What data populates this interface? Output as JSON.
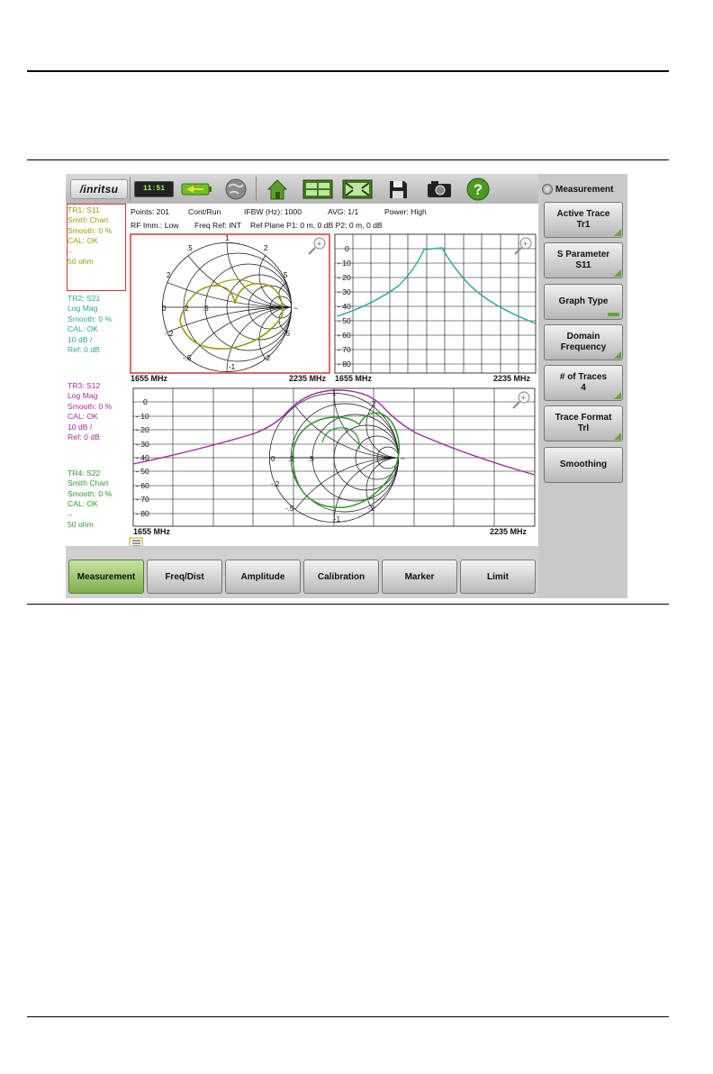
{
  "toolbar": {
    "logo": "/inritsu",
    "clock": "11:51"
  },
  "status": {
    "points": "Points: 201",
    "mode": "Cont/Run",
    "ifbw": "IFBW (Hz): 1000",
    "avg": "AVG: 1/1",
    "power": "Power: High",
    "rf_imm": "RF Imm.: Low",
    "freq_ref": "Freq Ref: INT",
    "ref_plane": "Ref Plane P1: 0 m, 0 dB P2: 0 m, 0 dB"
  },
  "traces": [
    {
      "lines": [
        "TR1: S11",
        "Smith Chart",
        "Smooth: 0 %",
        "CAL: OK",
        "--",
        "50 ohm"
      ],
      "color": "#9a9a10"
    },
    {
      "lines": [
        "TR2: S21",
        "Log Mag",
        "Smooth: 0 %",
        "CAL: OK",
        "10 dB /",
        "Ref: 0 dB"
      ],
      "color": "#2aa89a"
    },
    {
      "lines": [
        "TR3: S12",
        "Log Mag",
        "Smooth: 0 %",
        "CAL: OK",
        "10 dB /",
        "Ref: 0 dB"
      ],
      "color": "#a32aa8"
    },
    {
      "lines": [
        "TR4: S22",
        "Smith Chart",
        "Smooth: 0 %",
        "CAL: OK",
        "--",
        "50 ohm"
      ],
      "color": "#2a9a2a"
    }
  ],
  "plots": {
    "tr1_start": "1655 MHz",
    "tr1_stop": "2235 MHz",
    "tr2_start": "1655 MHz",
    "tr2_stop": "2235 MHz",
    "tr34_start": "1655 MHz",
    "tr34_stop": "2235 MHz",
    "db_ticks": [
      "0",
      "- 10",
      "- 20",
      "- 30",
      "- 40",
      "- 50",
      "- 60",
      "- 70",
      "- 80"
    ],
    "smith_labels": [
      "1",
      ".5",
      "2",
      ".2",
      "5",
      "0",
      ".2",
      ".5",
      "1",
      "2",
      "5",
      "~",
      "-.2",
      "-5",
      "-.5",
      "-2",
      "-1"
    ]
  },
  "right_panel": {
    "header": "Measurement",
    "buttons": [
      {
        "line1": "Active Trace",
        "line2": "Tr1"
      },
      {
        "line1": "S Parameter",
        "line2": "S11"
      },
      {
        "line1": "Graph Type",
        "line2": ""
      },
      {
        "line1": "Domain",
        "line2": "Frequency"
      },
      {
        "line1": "# of Traces",
        "line2": "4"
      },
      {
        "line1": "Trace Format",
        "line2": "Trl"
      },
      {
        "line1": "Smoothing",
        "line2": ""
      }
    ]
  },
  "bottom_menu": [
    "Measurement",
    "Freq/Dist",
    "Amplitude",
    "Calibration",
    "Marker",
    "Limit"
  ],
  "colors": {
    "tr1": "#9a9a10",
    "tr2": "#2aa89a",
    "tr3": "#a32aa8",
    "tr4": "#2a9a2a",
    "active_border": "#dd3333",
    "active_button": "#8fbe5a"
  }
}
